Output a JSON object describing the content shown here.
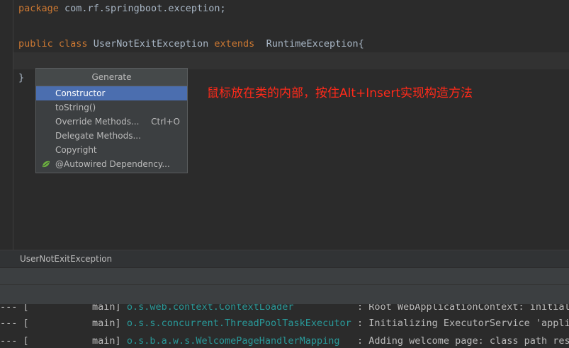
{
  "editor": {
    "line1": {
      "kw": "package",
      "rest": " com.rf.springboot.exception;"
    },
    "line2": {
      "kw1": "public",
      "kw2": "class",
      "name": "UserNotExitException",
      "kw3": "extends",
      "parent": "RuntimeException{"
    },
    "line3": "}"
  },
  "annotation": "鼠标放在类的内部，按住Alt+Insert实现构造方法",
  "generate_popup": {
    "title": "Generate",
    "items": [
      {
        "label": "Constructor",
        "shortcut": ""
      },
      {
        "label": "toString()",
        "shortcut": ""
      },
      {
        "label": "Override Methods...",
        "shortcut": "Ctrl+O"
      },
      {
        "label": "Delegate Methods...",
        "shortcut": ""
      },
      {
        "label": "Copyright",
        "shortcut": ""
      },
      {
        "label": "@Autowired Dependency...",
        "shortcut": "",
        "icon": "spring-leaf-icon"
      }
    ],
    "selected_index": 0
  },
  "breadcrumb": "UserNotExitException",
  "console": {
    "lines": [
      {
        "prefix": "--- [",
        "thread": "           main]",
        "logger": "o.s.web.context.ContextLoader",
        "msg": ": Root WebApplicationContext: initializ"
      },
      {
        "prefix": "--- [",
        "thread": "           main]",
        "logger": "o.s.s.concurrent.ThreadPoolTaskExecutor",
        "msg": ": Initializing ExecutorService 'applic"
      },
      {
        "prefix": "--- [",
        "thread": "           main]",
        "logger": "o.s.b.a.w.s.WelcomePageHandlerMapping",
        "msg": ": Adding welcome page: class path reso"
      }
    ]
  },
  "colors": {
    "keyword": "#cc7832",
    "text": "#a9b7c6",
    "selection": "#4b6eaf",
    "annotation": "#ff2a1a",
    "logger": "#299999"
  }
}
